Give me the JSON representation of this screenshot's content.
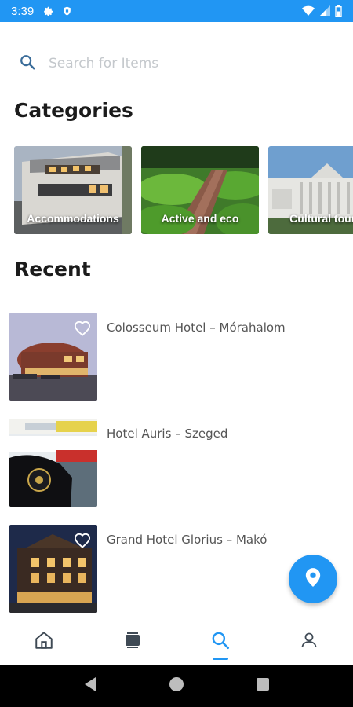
{
  "status_bar": {
    "time": "3:39",
    "background": "#2196f3",
    "left_icons": [
      "settings-gear-icon",
      "shield-icon"
    ],
    "right_icons": [
      "wifi-icon",
      "signal-icon",
      "battery-icon"
    ]
  },
  "search": {
    "placeholder": "Search for Items",
    "value": "",
    "icon": "search-icon"
  },
  "categories": {
    "title": "Categories",
    "items": [
      {
        "label": "Accommodations"
      },
      {
        "label": "Active and eco"
      },
      {
        "label": "Cultural touris"
      }
    ]
  },
  "recent": {
    "title": "Recent",
    "items": [
      {
        "name": "Colosseum Hotel – Mórahalom",
        "favorite_icon": "heart-outline-icon"
      },
      {
        "name": "Hotel Auris – Szeged",
        "favorite_icon": "heart-outline-icon"
      },
      {
        "name": "Grand Hotel Glorius – Makó",
        "favorite_icon": "heart-outline-icon"
      }
    ]
  },
  "fab": {
    "icon": "map-pin-icon",
    "color": "#2196f3"
  },
  "bottom_nav": {
    "items": [
      {
        "icon": "home-icon",
        "active": false
      },
      {
        "icon": "grid-card-icon",
        "active": false
      },
      {
        "icon": "search-icon",
        "active": true
      },
      {
        "icon": "profile-icon",
        "active": false
      }
    ],
    "active_color": "#2196f3",
    "inactive_color": "#3f4a55"
  },
  "system_nav": {
    "icons": [
      "back-icon",
      "home-circle-icon",
      "recents-square-icon"
    ]
  }
}
